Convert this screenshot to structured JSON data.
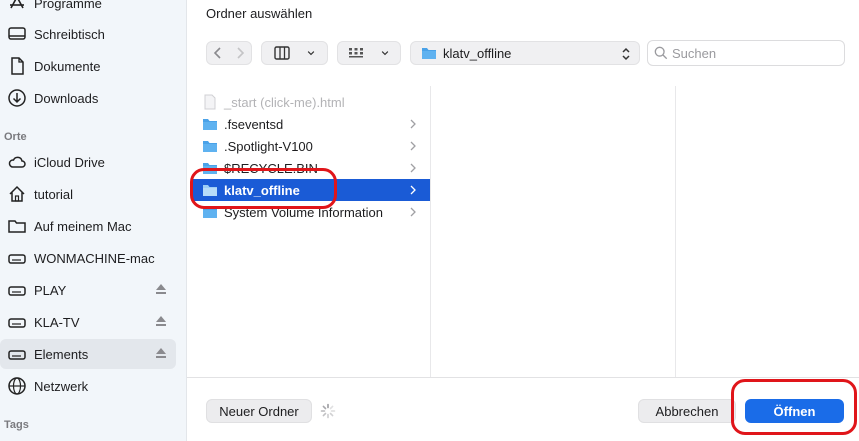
{
  "dialog": {
    "title": "Ordner auswählen"
  },
  "sidebar": {
    "items": [
      {
        "label": "Programme",
        "icon": "apps-icon"
      },
      {
        "label": "Schreibtisch",
        "icon": "desktop-icon"
      },
      {
        "label": "Dokumente",
        "icon": "document-icon"
      },
      {
        "label": "Downloads",
        "icon": "download-icon"
      }
    ],
    "section_orte": "Orte",
    "places": [
      {
        "label": "iCloud Drive",
        "icon": "cloud-icon"
      },
      {
        "label": "tutorial",
        "icon": "home-icon"
      },
      {
        "label": "Auf meinem Mac",
        "icon": "folder-icon"
      },
      {
        "label": "WONMACHINE-mac",
        "icon": "drive-icon"
      },
      {
        "label": "PLAY",
        "icon": "drive-icon",
        "eject": true
      },
      {
        "label": "KLA-TV",
        "icon": "drive-icon",
        "eject": true
      },
      {
        "label": "Elements",
        "icon": "drive-icon",
        "eject": true,
        "selected": true
      },
      {
        "label": "Netzwerk",
        "icon": "globe-icon"
      }
    ],
    "section_tags": "Tags"
  },
  "toolbar": {
    "path": "klatv_offline",
    "search_placeholder": "Suchen"
  },
  "files": [
    {
      "name": "_start (click-me).html",
      "type": "file",
      "disabled": true
    },
    {
      "name": ".fseventsd",
      "type": "folder"
    },
    {
      "name": ".Spotlight-V100",
      "type": "folder"
    },
    {
      "name": "$RECYCLE.BIN",
      "type": "folder"
    },
    {
      "name": "klatv_offline",
      "type": "folder",
      "selected": true
    },
    {
      "name": "System Volume Information",
      "type": "folder"
    }
  ],
  "footer": {
    "new_folder": "Neuer Ordner",
    "cancel": "Abbrechen",
    "open": "Öffnen"
  },
  "colors": {
    "accent": "#1a6ce8",
    "selection": "#1a5bd6",
    "highlight": "#e0151a",
    "folder": "#4aa2e8"
  }
}
